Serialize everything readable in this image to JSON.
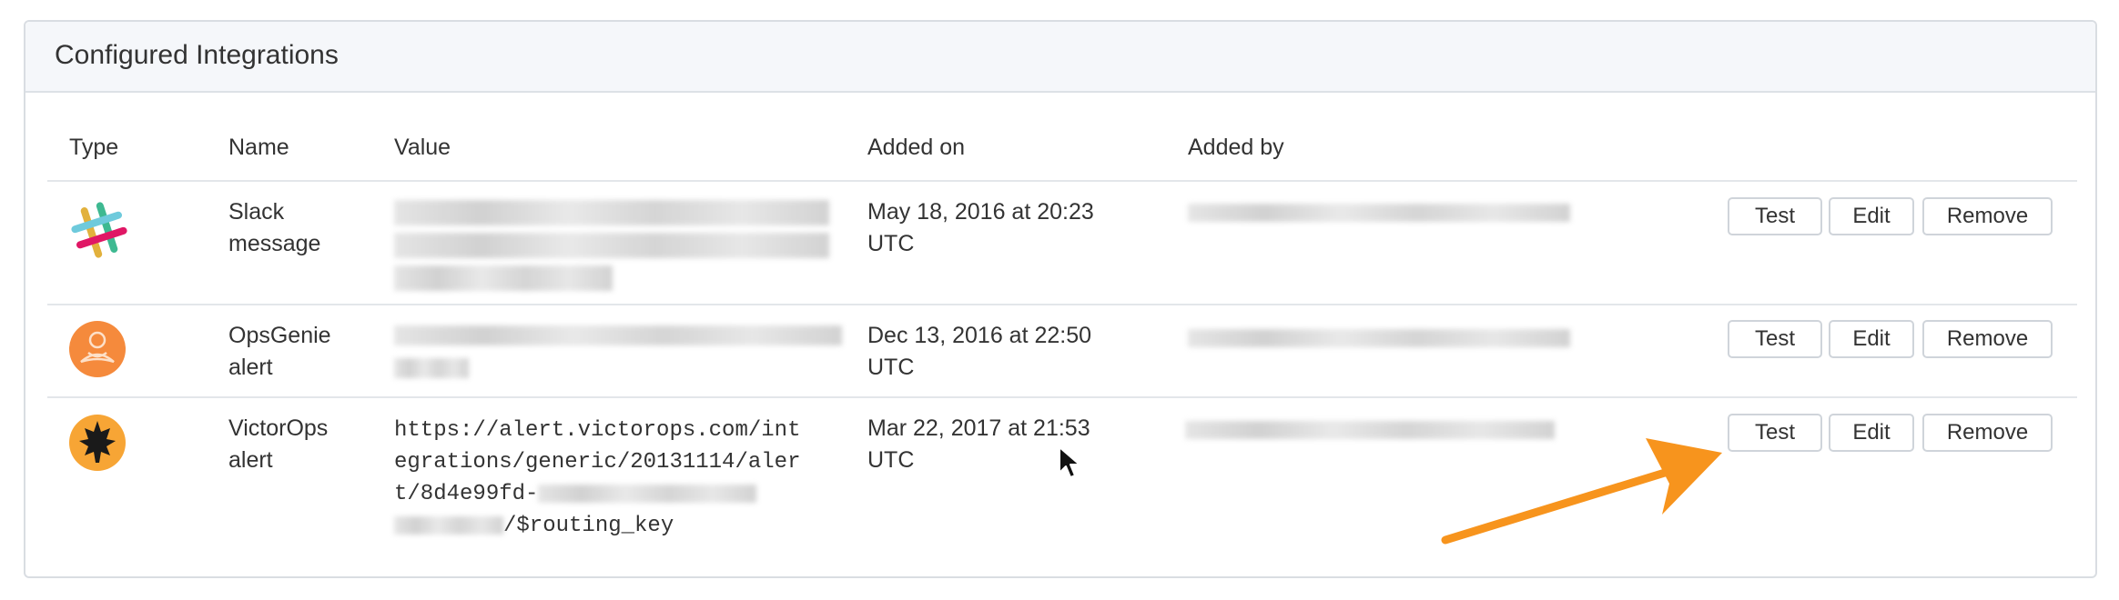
{
  "panel": {
    "title": "Configured Integrations"
  },
  "table": {
    "columns": {
      "type": "Type",
      "name": "Name",
      "value": "Value",
      "added_on": "Added on",
      "added_by": "Added by"
    },
    "rows": [
      {
        "icon": "slack-icon",
        "name_line1": "Slack",
        "name_line2": "message",
        "added_line1": "May 18, 2016 at 20:23",
        "added_line2": "UTC",
        "buttons": {
          "test": "Test",
          "edit": "Edit",
          "remove": "Remove"
        }
      },
      {
        "icon": "opsgenie-icon",
        "name_line1": "OpsGenie",
        "name_line2": "alert",
        "added_line1": "Dec 13, 2016 at 22:50",
        "added_line2": "UTC",
        "buttons": {
          "test": "Test",
          "edit": "Edit",
          "remove": "Remove"
        }
      },
      {
        "icon": "victorops-icon",
        "name_line1": "VictorOps",
        "name_line2": "alert",
        "value_line1": "https://alert.victorops.com/int",
        "value_line2": "egrations/generic/20131114/aler",
        "value_line3": "t/8d4e99fd-",
        "value_line4": "/$routing_key",
        "added_line1": "Mar 22, 2017 at 21:53",
        "added_line2": "UTC",
        "buttons": {
          "test": "Test",
          "edit": "Edit",
          "remove": "Remove"
        }
      }
    ]
  },
  "colors": {
    "accent_arrow": "#f7941d",
    "opsgenie": "#f58a3c",
    "victorops": "#f7a535"
  }
}
